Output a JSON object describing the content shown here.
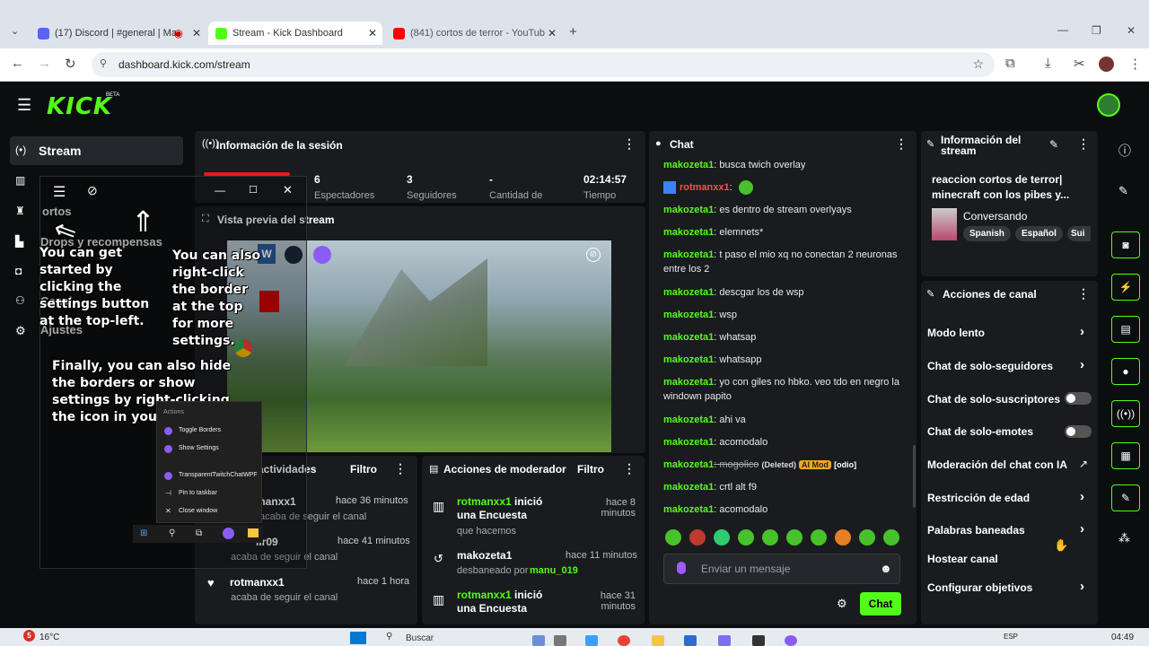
{
  "browser": {
    "tabs": [
      {
        "label": "(17) Discord | #general | Ma",
        "color": "#5865f2"
      },
      {
        "label": "Stream - Kick Dashboard",
        "color": "#53fc18"
      },
      {
        "label": "(841) cortos de terror - YouTub",
        "color": "#ff0000"
      }
    ],
    "url": "dashboard.kick.com/stream"
  },
  "kick": {
    "logo": "KICK",
    "beta": "BETA"
  },
  "sidebar": {
    "stream_label": "Stream",
    "overlay_items": [
      "ortos",
      "Drops y recompensas",
      "Canal",
      "Ajustes"
    ]
  },
  "session": {
    "title": "Información de la sesión",
    "stats": [
      "6",
      "3",
      "-",
      "02:14:57"
    ],
    "stat_labels": [
      "Espectadores",
      "Seguidores",
      "Cantidad de",
      "Tiempo"
    ]
  },
  "preview": {
    "title": "Vista previa del stream"
  },
  "activity": {
    "title": "actividades",
    "filter": "Filtro",
    "items": [
      {
        "user": "manxx1",
        "time": "hace 36 minutos",
        "action": "acaba de seguir el canal"
      },
      {
        "user": "lir09",
        "time": "hace 41 minutos",
        "action": "acaba de seguir el canal"
      },
      {
        "user": "rotmanxx1",
        "time": "hace 1 hora",
        "action": "acaba de seguir el canal"
      }
    ]
  },
  "moderator": {
    "title": "Acciones de moderador",
    "filter": "Filtro",
    "items": [
      {
        "user": "rotmanxx1",
        "text": "inició una Encuesta",
        "time": "hace 8 minutos",
        "sub": "que hacemos"
      },
      {
        "user": "makozeta1",
        "text": "",
        "time": "hace 11 minutos",
        "sub": "desbaneado por",
        "by": "manu_019"
      },
      {
        "user": "rotmanxx1",
        "text": "inició una Encuesta",
        "time": "hace 31 minutos",
        "sub": ""
      }
    ]
  },
  "chat": {
    "title": "Chat",
    "messages": [
      {
        "user": "makozeta1",
        "text": ": busca twich overlay"
      },
      {
        "user": "rotmanxx1",
        "text": ":",
        "red": true
      },
      {
        "user": "makozeta1",
        "text": ": es dentro de stream overlyays"
      },
      {
        "user": "makozeta1",
        "text": ": elemnets*"
      },
      {
        "user": "makozeta1",
        "text": ": t paso el mio xq no conectan 2 neuronas entre los 2"
      },
      {
        "user": "makozeta1",
        "text": ": descgar los de wsp"
      },
      {
        "user": "makozeta1",
        "text": ": wsp"
      },
      {
        "user": "makozeta1",
        "text": ": whatsap"
      },
      {
        "user": "makozeta1",
        "text": ": whatsapp"
      },
      {
        "user": "makozeta1",
        "text": ": yo con giles no hbko. veo tdo en negro la windown papito"
      },
      {
        "user": "makozeta1",
        "text": ": ahi va"
      },
      {
        "user": "makozeta1",
        "text": ": acomodalo"
      },
      {
        "user": "makozeta1",
        "text": ": mogolico",
        "deleted": "(Deleted)",
        "mod": "AI Mod",
        "tag": "[odio]"
      },
      {
        "user": "makozeta1",
        "text": ": crtl alt f9"
      },
      {
        "user": "makozeta1",
        "text": ": acomodalo"
      }
    ],
    "placeholder": "Enviar un mensaje",
    "send_label": "Chat"
  },
  "stream_info": {
    "title": "Información del stream",
    "stream_title": "reaccion cortos de terror| minecraft con los pibes y...",
    "category": "Conversando",
    "tags": [
      "Spanish",
      "Español",
      "Sui"
    ]
  },
  "channel_actions": {
    "title": "Acciones de canal",
    "items": [
      {
        "label": "Modo lento",
        "control": "chevron"
      },
      {
        "label": "Chat de solo-seguidores",
        "control": "chevron"
      },
      {
        "label": "Chat de solo-suscriptores",
        "control": "toggle"
      },
      {
        "label": "Chat de solo-emotes",
        "control": "toggle"
      },
      {
        "label": "Moderación del chat con IA",
        "control": "external"
      },
      {
        "label": "Restricción de edad",
        "control": "chevron"
      },
      {
        "label": "Palabras baneadas",
        "control": "chevron"
      },
      {
        "label": "Hostear canal",
        "control": "none"
      },
      {
        "label": "Configurar objetivos",
        "control": "chevron"
      }
    ]
  },
  "overlay": {
    "tip1": "You can get started by clicking the settings button at the top-left.",
    "tip2": "You can also right-click the border at the top for more settings.",
    "tip3": "Finally, you can also hide the borders or show settings by right-clicking the icon in your taskbar.",
    "menu_header": "Actions",
    "menu_items": [
      "Toggle Borders",
      "Show Settings",
      "TransparentTwitchChatWPF",
      "Pin to taskbar",
      "Close window"
    ]
  },
  "taskbar": {
    "weather": "16°C",
    "badge": "5",
    "search": "Buscar",
    "lang": "ESP",
    "time": "04:49"
  },
  "colors": {
    "accent": "#53fc18",
    "panel": "#191b1f",
    "background": "#0b0e0f"
  }
}
